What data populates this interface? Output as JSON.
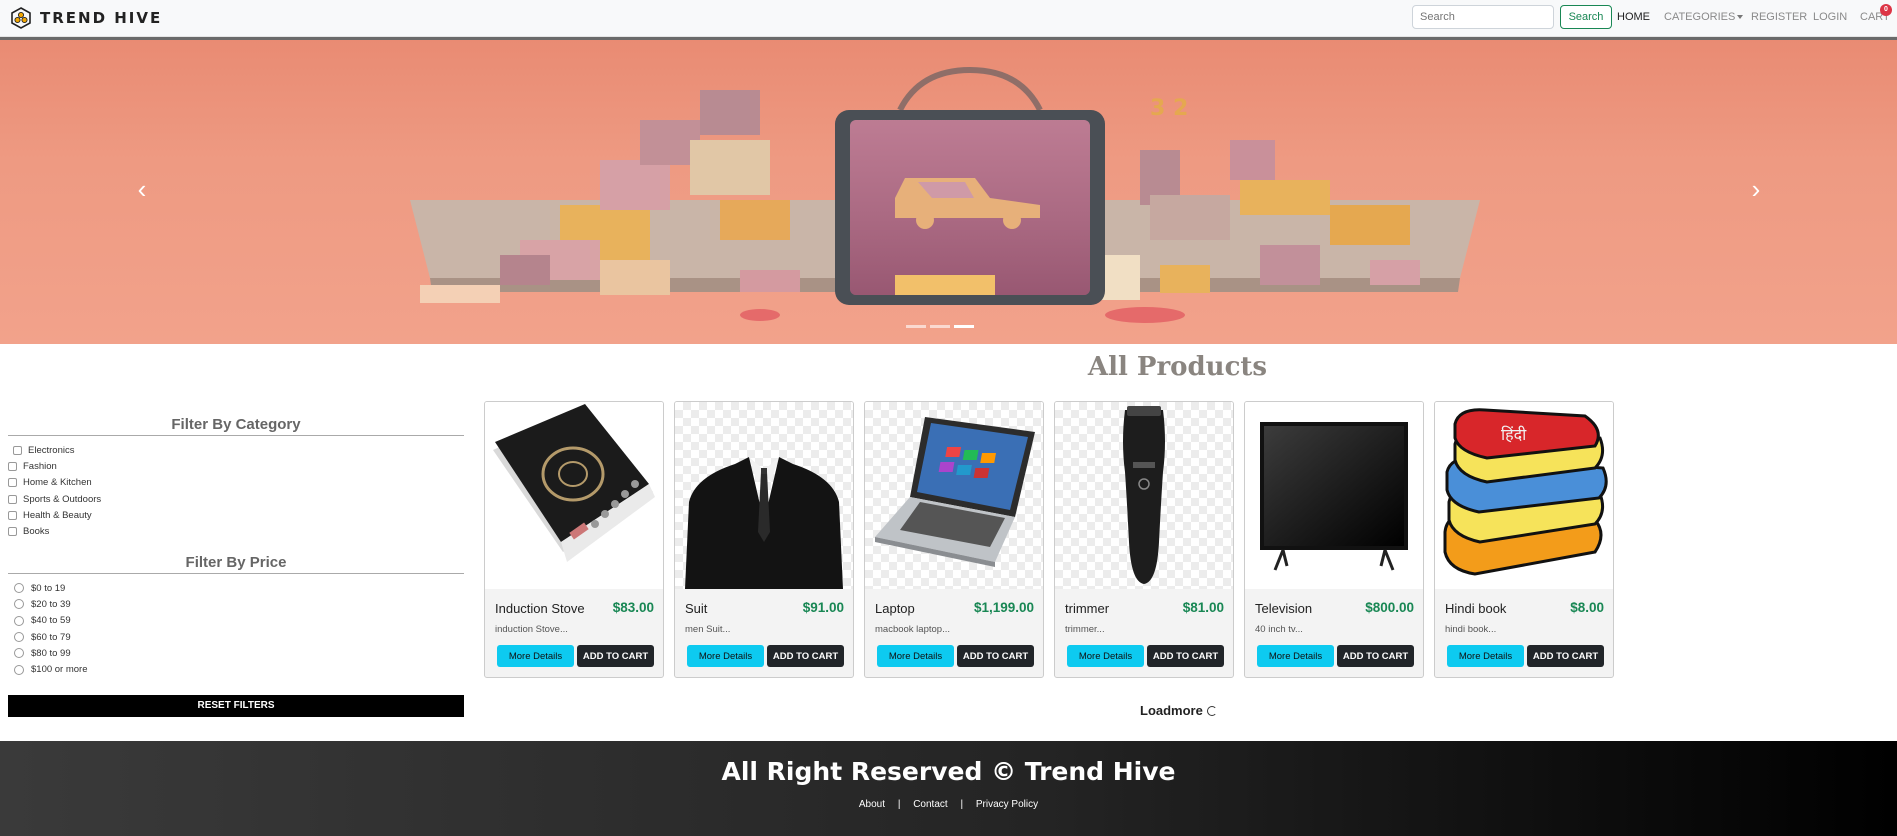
{
  "nav": {
    "brand": "TREND HIVE",
    "search_placeholder": "Search",
    "search_button": "Search",
    "links": [
      "HOME",
      "CATEGORIES",
      "REGISTER",
      "LOGIN",
      "CART"
    ],
    "cart_count": "0"
  },
  "main": {
    "title": "All Products",
    "loadmore": "Loadmore"
  },
  "filters": {
    "category_title": "Filter By Category",
    "categories": [
      "Electronics",
      "Fashion",
      "Home & Kitchen",
      "Sports & Outdoors",
      "Health & Beauty",
      "Books"
    ],
    "price_title": "Filter By Price",
    "prices": [
      "$0 to 19",
      "$20 to 39",
      "$40 to 59",
      "$60 to 79",
      "$80 to 99",
      "$100 or more"
    ],
    "reset": "RESET FILTERS"
  },
  "products": [
    {
      "name": "Induction Stove",
      "price": "$83.00",
      "desc": "induction Stove...",
      "details": "More Details",
      "cart": "ADD TO CART"
    },
    {
      "name": "Suit",
      "price": "$91.00",
      "desc": "men Suit...",
      "details": "More Details",
      "cart": "ADD TO CART"
    },
    {
      "name": "Laptop",
      "price": "$1,199.00",
      "desc": "macbook laptop...",
      "details": "More Details",
      "cart": "ADD TO CART"
    },
    {
      "name": "trimmer",
      "price": "$81.00",
      "desc": "trimmer...",
      "details": "More Details",
      "cart": "ADD TO CART"
    },
    {
      "name": "Television",
      "price": "$800.00",
      "desc": "40 inch tv...",
      "details": "More Details",
      "cart": "ADD TO CART"
    },
    {
      "name": "Hindi book",
      "price": "$8.00",
      "desc": "hindi book...",
      "details": "More Details",
      "cart": "ADD TO CART"
    }
  ],
  "book_cover_text": "हिंदी",
  "footer": {
    "title": "All Right Reserved © Trend Hive",
    "links": [
      "About",
      "Contact",
      "Privacy Policy"
    ],
    "separator": "|"
  }
}
